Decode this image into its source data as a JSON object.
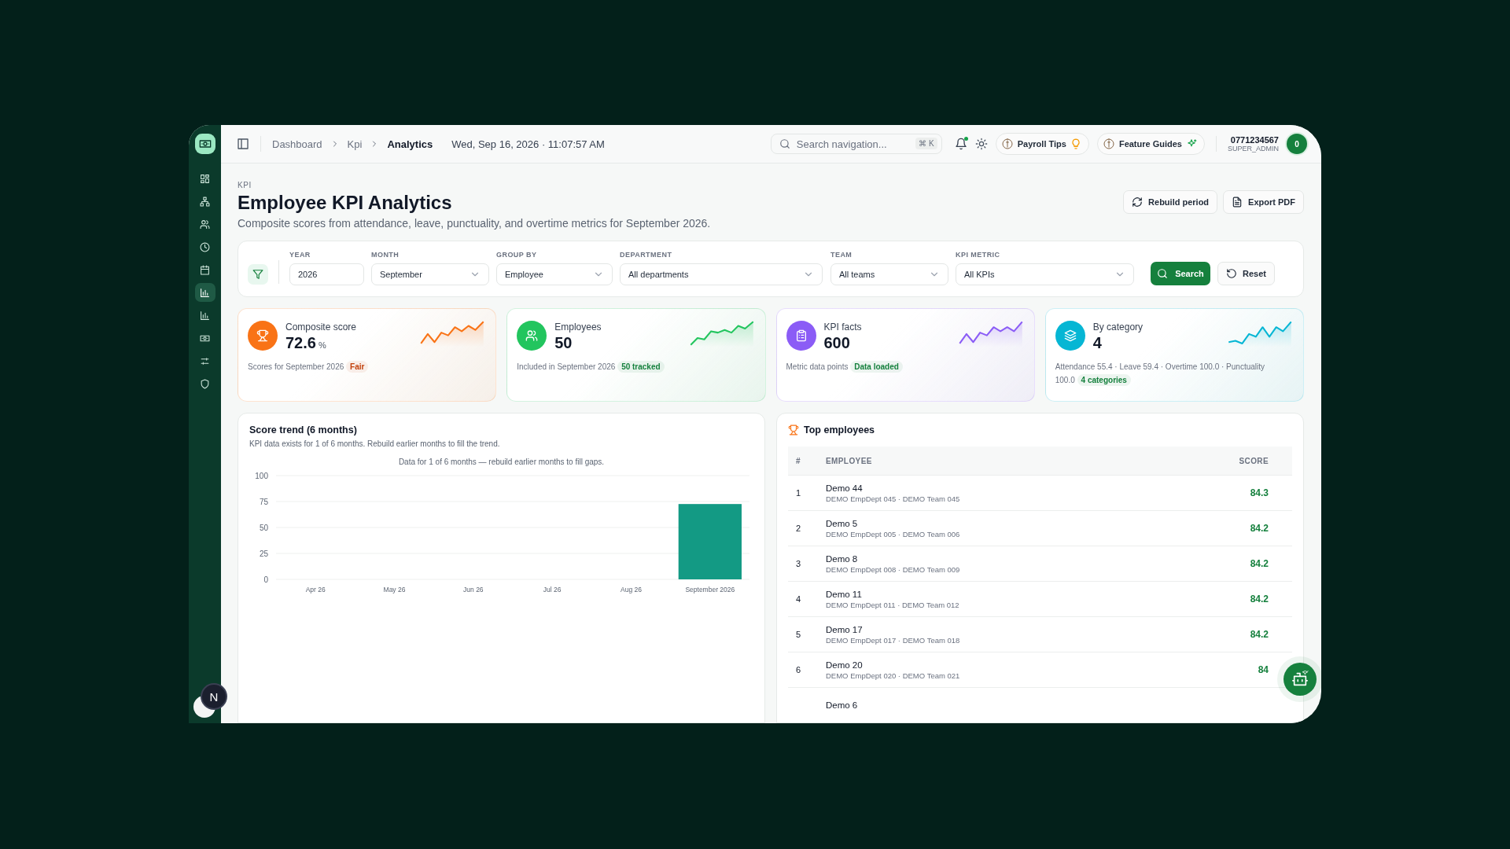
{
  "sidebar": {
    "items": [
      {
        "selected": false
      },
      {
        "selected": false
      },
      {
        "selected": false
      },
      {
        "selected": false
      },
      {
        "selected": false
      },
      {
        "selected": true
      },
      {
        "selected": false
      },
      {
        "selected": false
      },
      {
        "selected": false
      },
      {
        "selected": false
      }
    ],
    "dev_badge": "N"
  },
  "topbar": {
    "breadcrumb": [
      {
        "label": "Dashboard",
        "selected": false
      },
      {
        "label": "Kpi",
        "selected": false
      },
      {
        "label": "Analytics",
        "selected": true
      }
    ],
    "datetime": "Wed, Sep 16, 2026 · 11:07:57 AM",
    "search": {
      "placeholder": "Search navigation...",
      "shortcut": "⌘ K"
    },
    "notification_dot": true,
    "pills": [
      "Payroll Tips",
      "Feature Guides"
    ],
    "user": {
      "name": "0771234567",
      "role": "SUPER_ADMIN",
      "initial": "0"
    }
  },
  "header": {
    "eyebrow": "KPI",
    "title": "Employee KPI Analytics",
    "subtitle": "Composite scores from attendance, leave, punctuality, and overtime metrics for September 2026.",
    "buttons": [
      "Rebuild period",
      "Export PDF"
    ]
  },
  "filters": {
    "fields": [
      {
        "label": "YEAR",
        "value": "2026",
        "kind": "input"
      },
      {
        "label": "MONTH",
        "value": "September",
        "kind": "select"
      },
      {
        "label": "GROUP BY",
        "value": "Employee",
        "kind": "select"
      },
      {
        "label": "DEPARTMENT",
        "value": "All departments",
        "kind": "select"
      },
      {
        "label": "TEAM",
        "value": "All teams",
        "kind": "select"
      },
      {
        "label": "KPI METRIC",
        "value": "All KPIs",
        "kind": "select"
      }
    ],
    "search_button": "Search",
    "reset_button": "Reset"
  },
  "cards": [
    {
      "title": "Composite score",
      "value": "72.6",
      "unit": "%",
      "caption": "Scores for September 2026",
      "badge": {
        "text": "Fair",
        "color": "#c2410c"
      },
      "color": "#f97316"
    },
    {
      "title": "Employees",
      "value": "50",
      "caption": "Included in September 2026",
      "badge": {
        "text": "50 tracked",
        "color": "#15803d"
      },
      "color": "#22c55e"
    },
    {
      "title": "KPI facts",
      "value": "600",
      "caption": "Metric data points",
      "badge": {
        "text": "Data loaded",
        "color": "#15803d"
      },
      "color": "#8b5cf6"
    },
    {
      "title": "By category",
      "value": "4",
      "caption": "Attendance 55.4 · Leave 59.4 · Overtime 100.0 · Punctuality 100.0",
      "badge": {
        "text": "4 categories",
        "color": "#15803d"
      },
      "color": "#06b6d4"
    }
  ],
  "trend": {
    "title": "Score trend (6 months)",
    "subtitle": "KPI data exists for 1 of 6 months. Rebuild earlier months to fill the trend.",
    "note": "Data for 1 of 6 months — rebuild earlier months to fill gaps.",
    "chart_data": {
      "type": "bar",
      "categories": [
        "Apr 26",
        "May 26",
        "Jun 26",
        "Jul 26",
        "Aug 26",
        "September 2026"
      ],
      "series": [
        {
          "color": "#139a84",
          "values": [
            null,
            null,
            null,
            null,
            null,
            72.6
          ]
        }
      ],
      "ylim": [
        0,
        100
      ],
      "yticks": [
        0,
        25,
        50,
        75,
        100
      ],
      "grid": true
    }
  },
  "top": {
    "title": "Top employees",
    "columns": [
      "#",
      "EMPLOYEE",
      "SCORE"
    ],
    "rows": [
      {
        "rank": "1",
        "name": "Demo 44",
        "detail": "DEMO EmpDept 045 · DEMO Team 045",
        "score": "84.3"
      },
      {
        "rank": "2",
        "name": "Demo 5",
        "detail": "DEMO EmpDept 005 · DEMO Team 006",
        "score": "84.2"
      },
      {
        "rank": "3",
        "name": "Demo 8",
        "detail": "DEMO EmpDept 008 · DEMO Team 009",
        "score": "84.2"
      },
      {
        "rank": "4",
        "name": "Demo 11",
        "detail": "DEMO EmpDept 011 · DEMO Team 012",
        "score": "84.2"
      },
      {
        "rank": "5",
        "name": "Demo 17",
        "detail": "DEMO EmpDept 017 · DEMO Team 018",
        "score": "84.2"
      },
      {
        "rank": "6",
        "name": "Demo 20",
        "detail": "DEMO EmpDept 020 · DEMO Team 021",
        "score": "84"
      },
      {
        "rank": "",
        "name": "Demo 6",
        "detail": "",
        "score": ""
      }
    ]
  }
}
